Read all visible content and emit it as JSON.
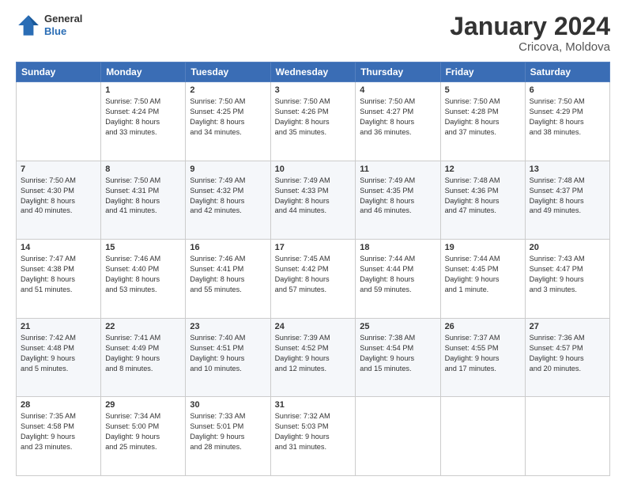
{
  "header": {
    "logo_line1": "General",
    "logo_line2": "Blue",
    "title": "January 2024",
    "subtitle": "Cricova, Moldova"
  },
  "columns": [
    "Sunday",
    "Monday",
    "Tuesday",
    "Wednesday",
    "Thursday",
    "Friday",
    "Saturday"
  ],
  "weeks": [
    [
      {
        "day": "",
        "info": ""
      },
      {
        "day": "1",
        "info": "Sunrise: 7:50 AM\nSunset: 4:24 PM\nDaylight: 8 hours\nand 33 minutes."
      },
      {
        "day": "2",
        "info": "Sunrise: 7:50 AM\nSunset: 4:25 PM\nDaylight: 8 hours\nand 34 minutes."
      },
      {
        "day": "3",
        "info": "Sunrise: 7:50 AM\nSunset: 4:26 PM\nDaylight: 8 hours\nand 35 minutes."
      },
      {
        "day": "4",
        "info": "Sunrise: 7:50 AM\nSunset: 4:27 PM\nDaylight: 8 hours\nand 36 minutes."
      },
      {
        "day": "5",
        "info": "Sunrise: 7:50 AM\nSunset: 4:28 PM\nDaylight: 8 hours\nand 37 minutes."
      },
      {
        "day": "6",
        "info": "Sunrise: 7:50 AM\nSunset: 4:29 PM\nDaylight: 8 hours\nand 38 minutes."
      }
    ],
    [
      {
        "day": "7",
        "info": "Sunrise: 7:50 AM\nSunset: 4:30 PM\nDaylight: 8 hours\nand 40 minutes."
      },
      {
        "day": "8",
        "info": "Sunrise: 7:50 AM\nSunset: 4:31 PM\nDaylight: 8 hours\nand 41 minutes."
      },
      {
        "day": "9",
        "info": "Sunrise: 7:49 AM\nSunset: 4:32 PM\nDaylight: 8 hours\nand 42 minutes."
      },
      {
        "day": "10",
        "info": "Sunrise: 7:49 AM\nSunset: 4:33 PM\nDaylight: 8 hours\nand 44 minutes."
      },
      {
        "day": "11",
        "info": "Sunrise: 7:49 AM\nSunset: 4:35 PM\nDaylight: 8 hours\nand 46 minutes."
      },
      {
        "day": "12",
        "info": "Sunrise: 7:48 AM\nSunset: 4:36 PM\nDaylight: 8 hours\nand 47 minutes."
      },
      {
        "day": "13",
        "info": "Sunrise: 7:48 AM\nSunset: 4:37 PM\nDaylight: 8 hours\nand 49 minutes."
      }
    ],
    [
      {
        "day": "14",
        "info": "Sunrise: 7:47 AM\nSunset: 4:38 PM\nDaylight: 8 hours\nand 51 minutes."
      },
      {
        "day": "15",
        "info": "Sunrise: 7:46 AM\nSunset: 4:40 PM\nDaylight: 8 hours\nand 53 minutes."
      },
      {
        "day": "16",
        "info": "Sunrise: 7:46 AM\nSunset: 4:41 PM\nDaylight: 8 hours\nand 55 minutes."
      },
      {
        "day": "17",
        "info": "Sunrise: 7:45 AM\nSunset: 4:42 PM\nDaylight: 8 hours\nand 57 minutes."
      },
      {
        "day": "18",
        "info": "Sunrise: 7:44 AM\nSunset: 4:44 PM\nDaylight: 8 hours\nand 59 minutes."
      },
      {
        "day": "19",
        "info": "Sunrise: 7:44 AM\nSunset: 4:45 PM\nDaylight: 9 hours\nand 1 minute."
      },
      {
        "day": "20",
        "info": "Sunrise: 7:43 AM\nSunset: 4:47 PM\nDaylight: 9 hours\nand 3 minutes."
      }
    ],
    [
      {
        "day": "21",
        "info": "Sunrise: 7:42 AM\nSunset: 4:48 PM\nDaylight: 9 hours\nand 5 minutes."
      },
      {
        "day": "22",
        "info": "Sunrise: 7:41 AM\nSunset: 4:49 PM\nDaylight: 9 hours\nand 8 minutes."
      },
      {
        "day": "23",
        "info": "Sunrise: 7:40 AM\nSunset: 4:51 PM\nDaylight: 9 hours\nand 10 minutes."
      },
      {
        "day": "24",
        "info": "Sunrise: 7:39 AM\nSunset: 4:52 PM\nDaylight: 9 hours\nand 12 minutes."
      },
      {
        "day": "25",
        "info": "Sunrise: 7:38 AM\nSunset: 4:54 PM\nDaylight: 9 hours\nand 15 minutes."
      },
      {
        "day": "26",
        "info": "Sunrise: 7:37 AM\nSunset: 4:55 PM\nDaylight: 9 hours\nand 17 minutes."
      },
      {
        "day": "27",
        "info": "Sunrise: 7:36 AM\nSunset: 4:57 PM\nDaylight: 9 hours\nand 20 minutes."
      }
    ],
    [
      {
        "day": "28",
        "info": "Sunrise: 7:35 AM\nSunset: 4:58 PM\nDaylight: 9 hours\nand 23 minutes."
      },
      {
        "day": "29",
        "info": "Sunrise: 7:34 AM\nSunset: 5:00 PM\nDaylight: 9 hours\nand 25 minutes."
      },
      {
        "day": "30",
        "info": "Sunrise: 7:33 AM\nSunset: 5:01 PM\nDaylight: 9 hours\nand 28 minutes."
      },
      {
        "day": "31",
        "info": "Sunrise: 7:32 AM\nSunset: 5:03 PM\nDaylight: 9 hours\nand 31 minutes."
      },
      {
        "day": "",
        "info": ""
      },
      {
        "day": "",
        "info": ""
      },
      {
        "day": "",
        "info": ""
      }
    ]
  ]
}
